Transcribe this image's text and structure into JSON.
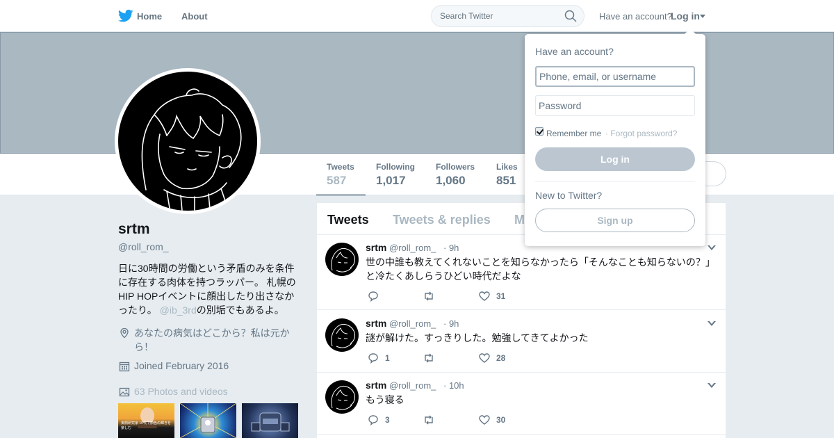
{
  "nav": {
    "home_label": "Home",
    "about_label": "About",
    "search_placeholder": "Search Twitter",
    "have_account": "Have an account?",
    "login_label": "Log in"
  },
  "profile": {
    "name": "srtm",
    "handle": "@roll_rom_",
    "bio_text": "日に30時間の労働という矛盾のみを条件に存在する肉体を持つラッパー。 札幌のHIP HOPイベントに顔出したり出さなかったり。",
    "bio_mention": "@ib_3rd",
    "bio_suffix": "の別垢でもあるよ。",
    "location": "あなたの病気はどこから？私は元から！",
    "joined": "Joined February 2016",
    "photos_label": "63 Photos and videos",
    "thumb1_text": "美顔研究家 10代で顔色の輝きを楽しむ"
  },
  "stats": [
    {
      "label": "Tweets",
      "value": "587"
    },
    {
      "label": "Following",
      "value": "1,017"
    },
    {
      "label": "Followers",
      "value": "1,060"
    },
    {
      "label": "Likes",
      "value": "851"
    }
  ],
  "timeline": {
    "tabs": [
      "Tweets",
      "Tweets & replies",
      "M"
    ],
    "tweets": [
      {
        "name": "srtm",
        "handle": "@roll_rom_",
        "time": "· 9h",
        "text": "世の中誰も教えてくれないことを知らなかったら「そんなことも知らないの？」と冷たくあしらうひどい時代だよな",
        "replies": "",
        "retweets": "",
        "likes": "31"
      },
      {
        "name": "srtm",
        "handle": "@roll_rom_",
        "time": "· 9h",
        "text": "謎が解けた。すっきりした。勉強してきてよかった",
        "replies": "1",
        "retweets": "",
        "likes": "28"
      },
      {
        "name": "srtm",
        "handle": "@roll_rom_",
        "time": "· 10h",
        "text": "もう寝る",
        "replies": "3",
        "retweets": "",
        "likes": "30"
      }
    ]
  },
  "login_dropdown": {
    "title": "Have an account?",
    "username_placeholder": "Phone, email, or username",
    "password_placeholder": "Password",
    "remember_label": "Remember me",
    "forgot_label": "· Forgot password?",
    "login_button": "Log in",
    "new_to": "New to Twitter?",
    "signup_button": "Sign up"
  },
  "colors": {
    "accent_muted": "#aab8c2",
    "text_secondary": "#657786",
    "banner": "#aab8c2",
    "background": "#e6ecf0"
  },
  "icons": [
    "twitter-bird-icon",
    "search-icon",
    "location-pin-icon",
    "calendar-icon",
    "photo-icon",
    "reply-icon",
    "retweet-icon",
    "like-heart-icon",
    "chevron-down-icon"
  ]
}
